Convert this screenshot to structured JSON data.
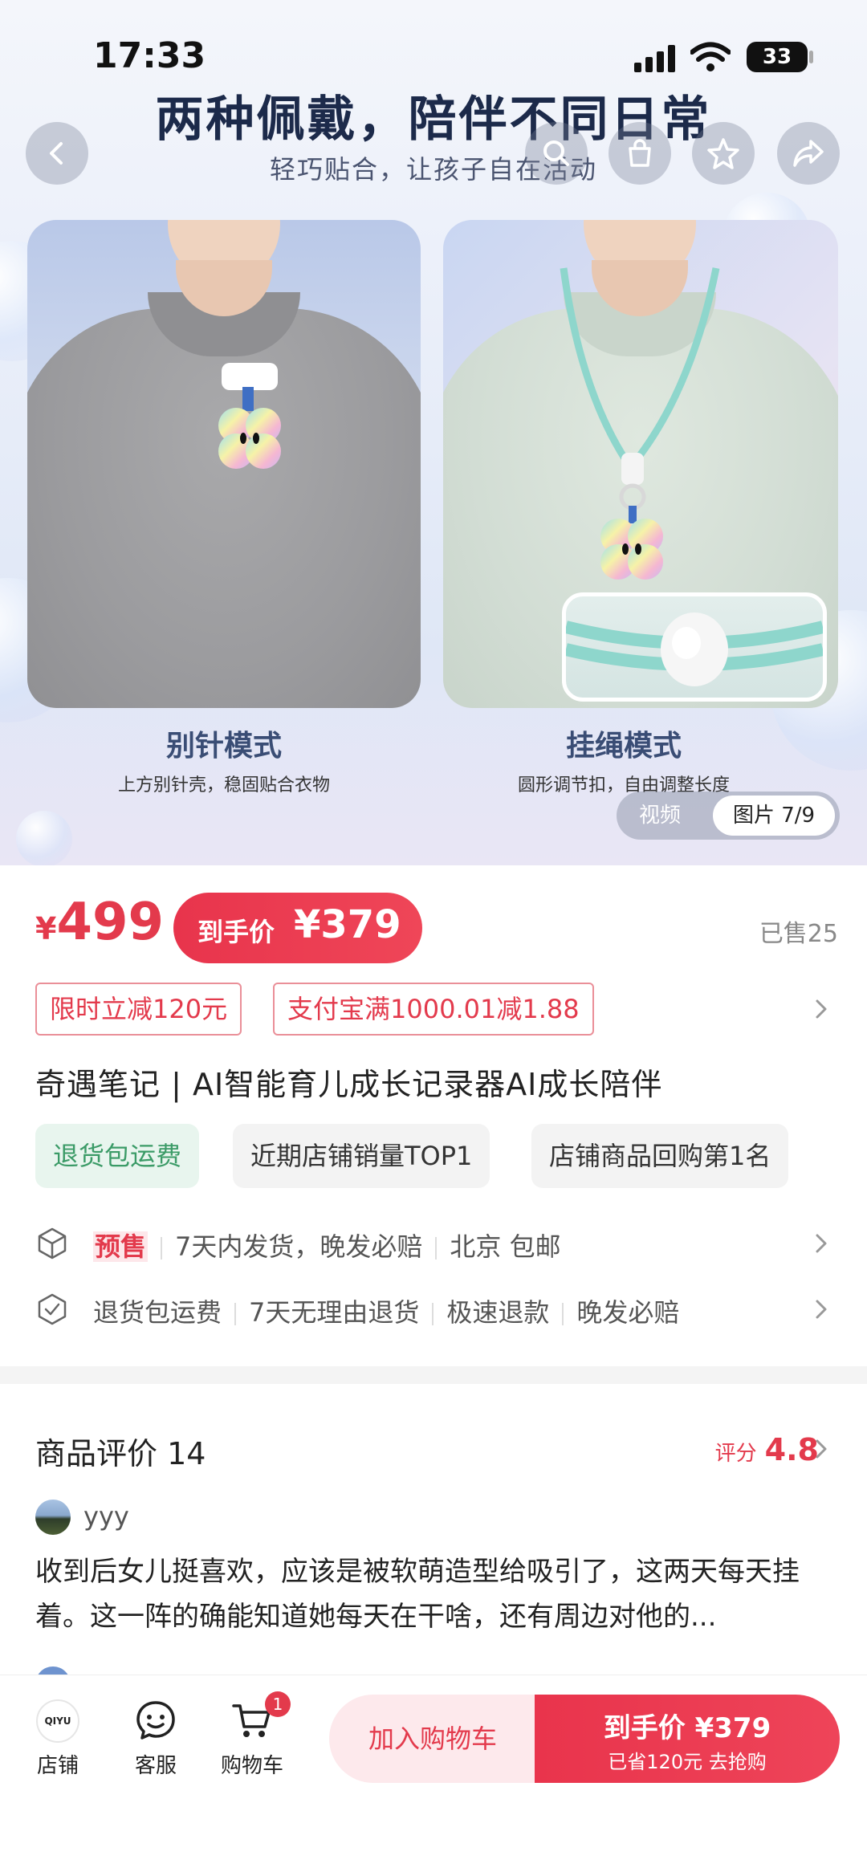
{
  "status": {
    "time": "17:33",
    "battery": "33"
  },
  "hero": {
    "title": "两种佩戴，陪伴不同日常",
    "subtitle": "轻巧贴合，让孩子自在活动",
    "left_mode": {
      "title": "别针模式",
      "desc": "上方别针壳，稳固贴合衣物"
    },
    "right_mode": {
      "title": "挂绳模式",
      "desc": "圆形调节扣，自由调整长度"
    },
    "media_video": "视频",
    "media_image": "图片 7/9"
  },
  "price": {
    "currency": "¥",
    "value": "499",
    "final_label": "到手价",
    "final_value": "¥379",
    "sold": "已售25"
  },
  "promos": [
    "限时立减120元",
    "支付宝满1000.01减1.88"
  ],
  "product_title": "奇遇笔记 | AI智能育儿成长记录器AI成长陪伴",
  "tags": [
    "退货包运费",
    "近期店铺销量TOP1",
    "店铺商品回购第1名"
  ],
  "shipping": {
    "presale": "预售",
    "items": [
      "7天内发货，晚发必赔",
      "北京 包邮"
    ]
  },
  "service": {
    "items": [
      "退货包运费",
      "7天无理由退货",
      "极速退款",
      "晚发必赔"
    ]
  },
  "reviews": {
    "title": "商品评价 14",
    "score_label": "评分",
    "score": "4.8",
    "first": {
      "user": "yyy",
      "text": "收到后女儿挺喜欢，应该是被软萌造型给吸引了，这两天每天挂着。这一阵的确能知道她每天在干啥，还有周边对他的..."
    }
  },
  "bottom": {
    "shop_logo": "QIYU",
    "shop": "店铺",
    "service": "客服",
    "cart": "购物车",
    "cart_count": "1",
    "add_cart": "加入购物车",
    "buy_line1": "到手价 ¥379",
    "buy_line2": "已省120元 去抢购"
  },
  "colors": {
    "accent": "#e33a4c",
    "green": "#3b9b67",
    "title": "#1c2a4a"
  }
}
